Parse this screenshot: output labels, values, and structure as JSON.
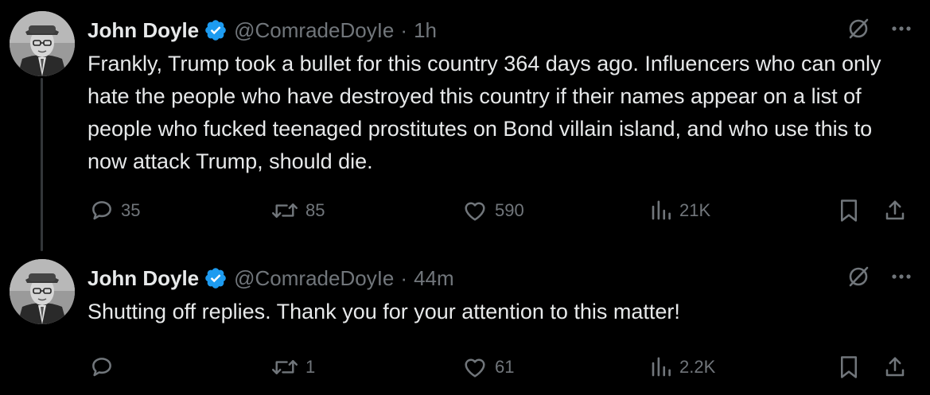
{
  "colors": {
    "background": "#000000",
    "text_primary": "#e7e9ea",
    "text_secondary": "#71767b",
    "verified_badge": "#1d9bf0",
    "thread_line": "#333639"
  },
  "tweets": [
    {
      "author_name": "John Doyle",
      "handle": "@ComradeDoyIe",
      "separator": "·",
      "time": "1h",
      "text": "Frankly, Trump took a bullet for this country 364 days ago. Influencers who can only hate the people who have destroyed this country if their names appear on a list of people who fucked teenaged prostitutes on Bond villain island, and who use this to now attack Trump, should die.",
      "replies": "35",
      "reposts": "85",
      "likes": "590",
      "views": "21K"
    },
    {
      "author_name": "John Doyle",
      "handle": "@ComradeDoyIe",
      "separator": "·",
      "time": "44m",
      "text": "Shutting off replies. Thank you for your attention to this matter!",
      "replies": "",
      "reposts": "1",
      "likes": "61",
      "views": "2.2K"
    }
  ],
  "icons": {
    "verified": "verified-badge-icon",
    "grok": "grok-slash-icon",
    "more": "more-dots-icon",
    "reply": "reply-bubble-icon",
    "repost": "repost-arrows-icon",
    "like": "heart-icon",
    "views": "analytics-bars-icon",
    "bookmark": "bookmark-icon",
    "share": "share-upload-icon"
  }
}
